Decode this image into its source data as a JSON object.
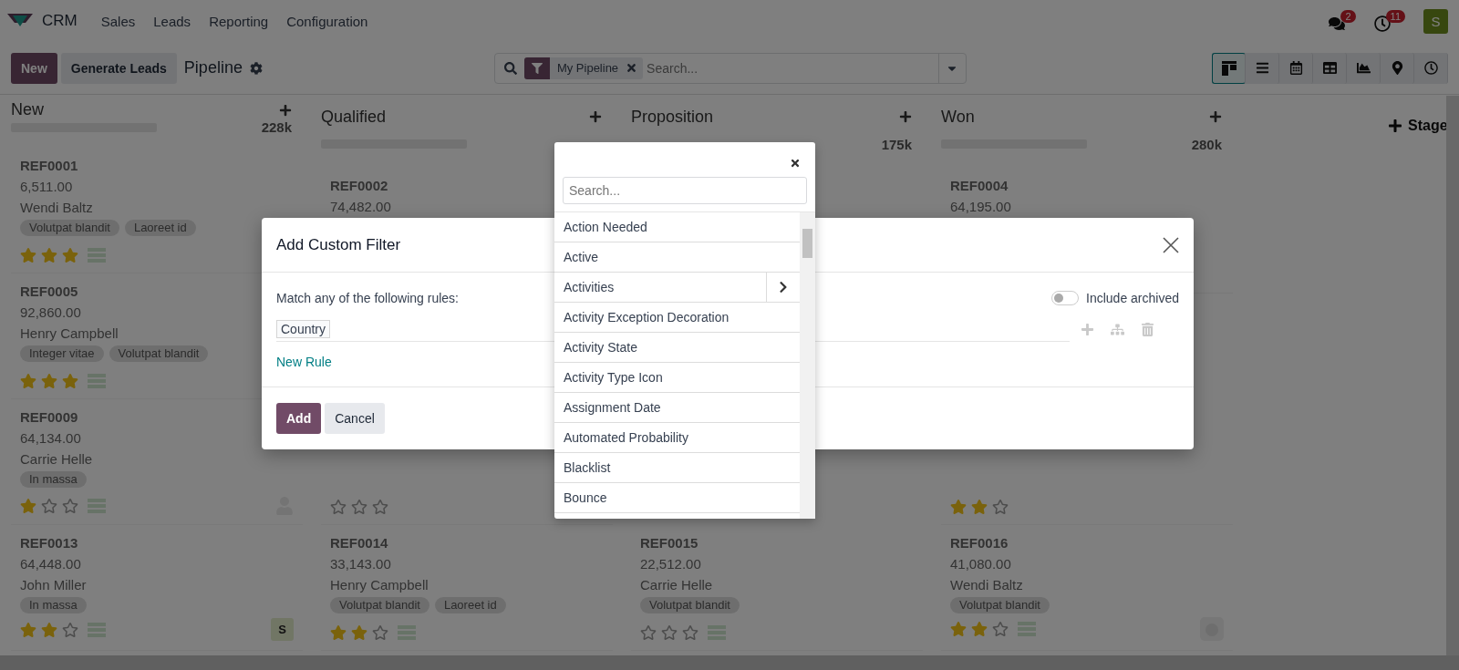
{
  "nav": {
    "app": "CRM",
    "menus": [
      "Sales",
      "Leads",
      "Reporting",
      "Configuration"
    ],
    "chat_badge": "2",
    "activity_badge": "11",
    "user_initial": "S"
  },
  "control": {
    "buttons": [
      {
        "label": "New",
        "kind": "primary"
      },
      {
        "label": "Generate Leads",
        "kind": "secondary"
      }
    ],
    "title": "Pipeline",
    "facet": "My Pipeline",
    "search_placeholder": "Search...",
    "views": [
      {
        "kind": "kanban",
        "selected": true
      },
      {
        "kind": "list",
        "selected": false
      },
      {
        "kind": "calendar",
        "selected": false
      },
      {
        "kind": "pivot",
        "selected": false
      },
      {
        "kind": "graph",
        "selected": false
      },
      {
        "kind": "map",
        "selected": false
      },
      {
        "kind": "activity",
        "selected": false
      }
    ]
  },
  "columns": [
    {
      "title": "New",
      "total": "228k",
      "level": 1,
      "cards_above_dialog": [
        {
          "ref": "REF0001",
          "amount": "6,511.00",
          "customer": "Wendi Baltz",
          "tags": [
            "Volutpat blandit",
            "Laoreet id"
          ],
          "stars": 3
        },
        {
          "ref": "REF0005",
          "amount": "92,860.00",
          "customer": "Henry Campbell",
          "tags": [
            "Integer vitae",
            "Volutpat blandit"
          ],
          "stars": 3
        }
      ],
      "cards_below_dialog": [
        {
          "ref": "REF0009",
          "amount": "64,134.00",
          "customer": "Carrie Helle",
          "tags": [
            "In massa"
          ],
          "stars": 1,
          "avatar": {
            "kind": "person"
          }
        },
        {
          "ref": "REF0013",
          "amount": "64,448.00",
          "customer": "John Miller",
          "tags": [
            "In massa"
          ],
          "stars": 2,
          "avatar": {
            "kind": "initial",
            "text": "S"
          }
        }
      ]
    },
    {
      "title": "Qualified",
      "level": 1,
      "cards_above_dialog": [
        {
          "ref": "REF0002",
          "amount": "74,482.00"
        }
      ],
      "cards_below_dialog": [
        {
          "stars": 0
        },
        {
          "ref": "REF0014",
          "amount": "33,143.00",
          "customer": "Henry Campbell",
          "tags": [
            "Volutpat blandit",
            "Laoreet id"
          ],
          "stars": 2
        }
      ]
    },
    {
      "title": "Proposition",
      "total": "175k",
      "cards_below_dialog": [
        {
          "ref": "REF0015",
          "amount": "22,512.00",
          "customer": "Carrie Helle",
          "tags": [
            "Volutpat blandit"
          ],
          "stars": 0
        }
      ]
    },
    {
      "title": "Won",
      "total": "280k",
      "level": 1,
      "cards_above_dialog": [
        {
          "ref": "REF0004",
          "amount": "64,195.00"
        }
      ],
      "cards_below_dialog": [
        {
          "stars": 2
        },
        {
          "ref": "REF0016",
          "amount": "41,080.00",
          "customer": "Wendi Baltz",
          "tags": [
            "Volutpat blandit"
          ],
          "stars": 2,
          "avatar": {
            "kind": "photo"
          }
        }
      ]
    }
  ],
  "add_stage": "Stage",
  "dialog": {
    "title": "Add Custom Filter",
    "match_text": "Match any of the following rules:",
    "include_archived": {
      "label": "Include archived",
      "on": false
    },
    "rule_path": "Country",
    "new_rule": "New Rule",
    "buttons": [
      {
        "label": "Add",
        "kind": "primary"
      },
      {
        "label": "Cancel",
        "kind": "secondary"
      }
    ]
  },
  "field_picker": {
    "search_placeholder": "Search...",
    "fields": [
      {
        "label": "Action Needed",
        "kind": "field"
      },
      {
        "label": "Active",
        "kind": "field"
      },
      {
        "label": "Activities",
        "kind": "relation"
      },
      {
        "label": "Activity Exception Decoration",
        "kind": "field"
      },
      {
        "label": "Activity State",
        "kind": "field"
      },
      {
        "label": "Activity Type Icon",
        "kind": "field"
      },
      {
        "label": "Assignment Date",
        "kind": "field"
      },
      {
        "label": "Automated Probability",
        "kind": "field"
      },
      {
        "label": "Blacklist",
        "kind": "field"
      },
      {
        "label": "Bounce",
        "kind": "field"
      }
    ]
  }
}
